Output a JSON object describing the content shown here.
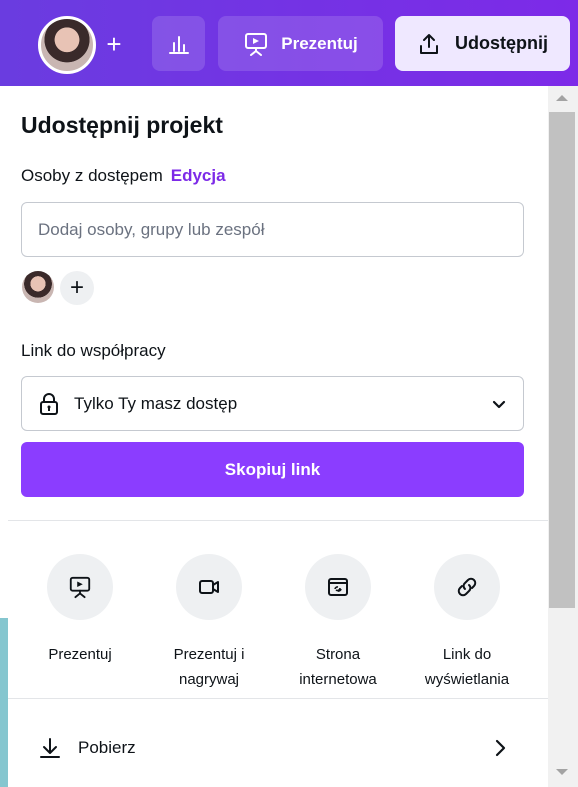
{
  "toolbar": {
    "add_label": "+",
    "present_label": "Prezentuj",
    "share_label": "Udostępnij"
  },
  "panel": {
    "title": "Udostępnij projekt",
    "access_label": "Osoby z dostępem",
    "edit_label": "Edycja",
    "people_placeholder": "Dodaj osoby, grupy lub zespół",
    "add_person_label": "+",
    "collab_label": "Link do współpracy",
    "link_access_value": "Tylko Ty masz dostęp",
    "copy_link_label": "Skopiuj link",
    "actions": [
      {
        "label": "Prezentuj",
        "icon": "present-icon"
      },
      {
        "label": "Prezentuj i nagrywaj",
        "icon": "camera-icon"
      },
      {
        "label": "Strona internetowa",
        "icon": "website-icon"
      },
      {
        "label": "Link do wyświetlania",
        "icon": "link-icon"
      }
    ],
    "download_label": "Pobierz"
  },
  "colors": {
    "toolbar_start": "#6a3ce0",
    "toolbar_end": "#7d2ae8",
    "accent": "#8b3dff",
    "edit_link": "#7d2ae8",
    "share_button_bg": "#efe8ff"
  }
}
